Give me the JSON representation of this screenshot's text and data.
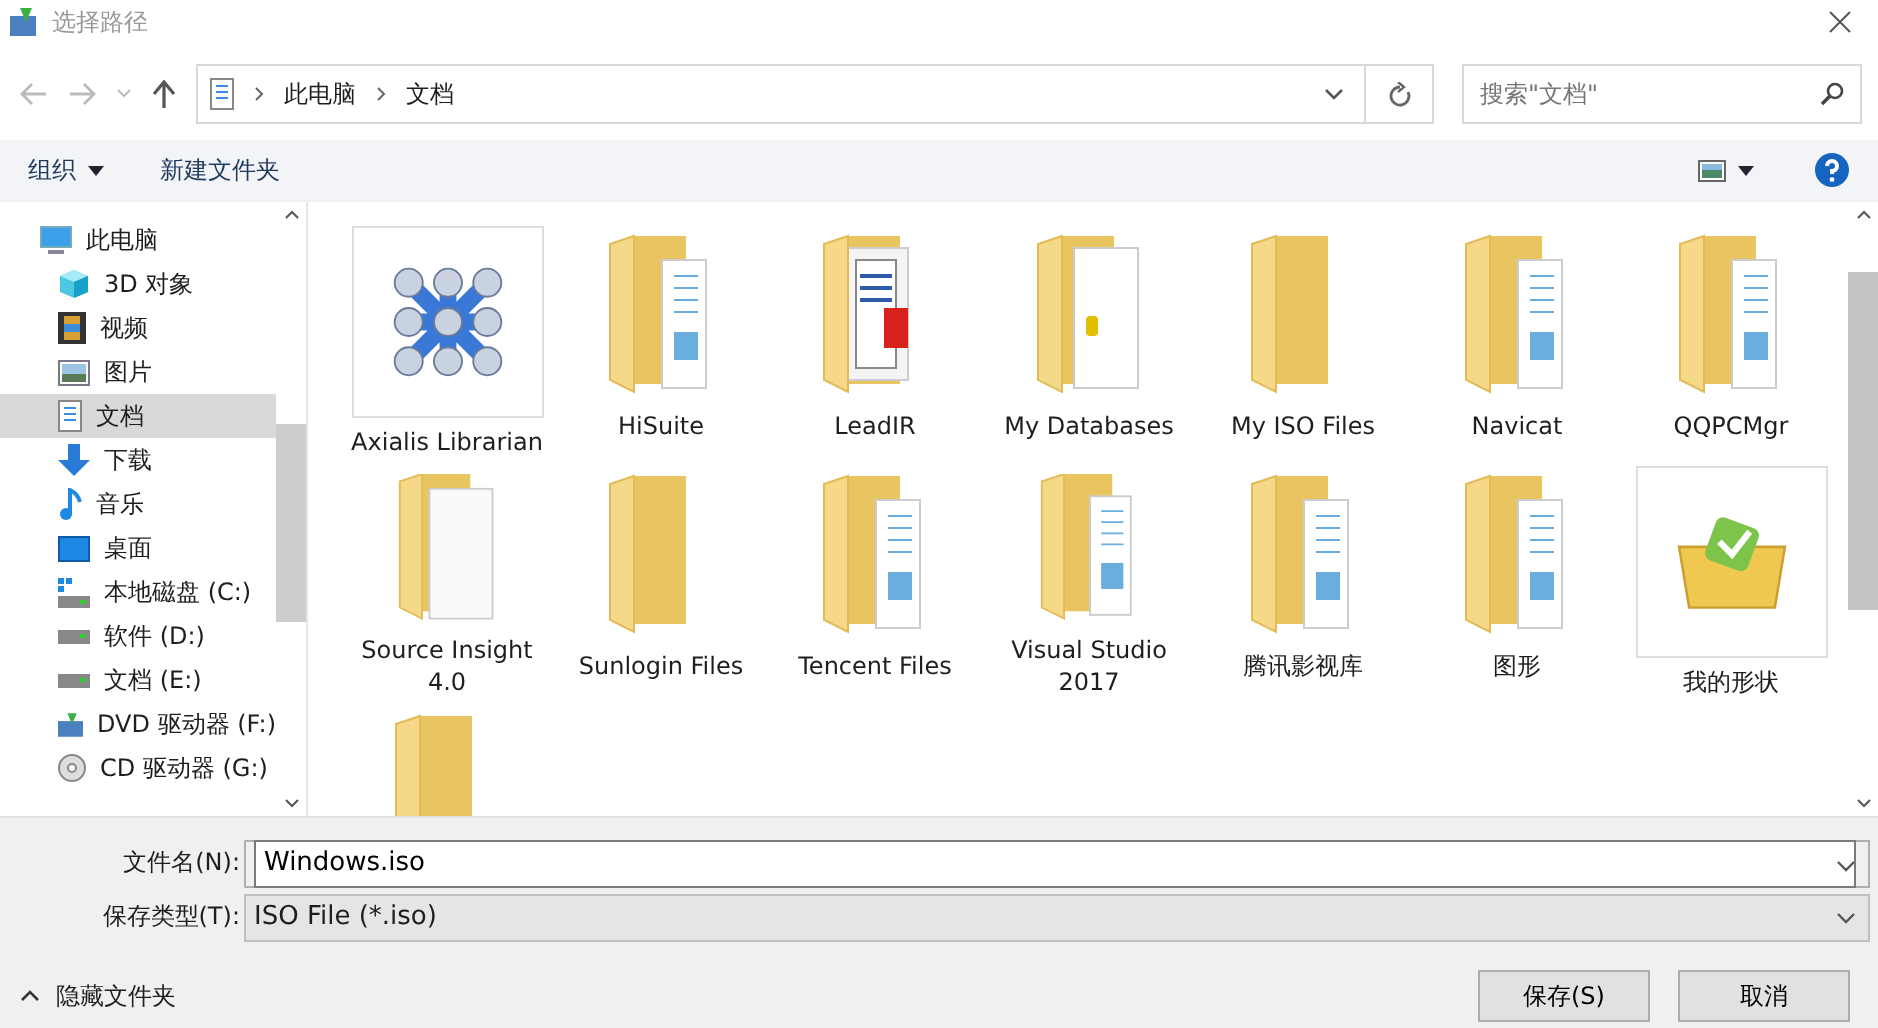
{
  "window": {
    "title": "选择路径"
  },
  "address": {
    "path": [
      "此电脑",
      "文档"
    ]
  },
  "search": {
    "placeholder": "搜索\"文档\""
  },
  "toolbar": {
    "organize": "组织",
    "new_folder": "新建文件夹"
  },
  "sidebar": {
    "items": [
      {
        "label": "此电脑",
        "kind": "pc",
        "selected": false,
        "children": [
          {
            "label": "3D 对象",
            "kind": "cube",
            "selected": false
          },
          {
            "label": "视频",
            "kind": "video",
            "selected": false
          },
          {
            "label": "图片",
            "kind": "picture",
            "selected": false
          },
          {
            "label": "文档",
            "kind": "document",
            "selected": true
          },
          {
            "label": "下载",
            "kind": "download",
            "selected": false
          },
          {
            "label": "音乐",
            "kind": "music",
            "selected": false
          },
          {
            "label": "桌面",
            "kind": "desktop",
            "selected": false
          },
          {
            "label": "本地磁盘 (C:)",
            "kind": "system-drive",
            "selected": false
          },
          {
            "label": "软件 (D:)",
            "kind": "drive",
            "selected": false
          },
          {
            "label": "文档 (E:)",
            "kind": "drive",
            "selected": false
          },
          {
            "label": "DVD 驱动器 (F:)",
            "kind": "dvd",
            "selected": false
          },
          {
            "label": "CD 驱动器 (G:)",
            "kind": "cd",
            "selected": false
          }
        ]
      }
    ]
  },
  "files": [
    {
      "name": "Axialis Librarian",
      "kind": "app"
    },
    {
      "name": "HiSuite",
      "kind": "folder-files"
    },
    {
      "name": "LeadIR",
      "kind": "folder-documents"
    },
    {
      "name": "My Databases",
      "kind": "folder-page"
    },
    {
      "name": "My ISO Files",
      "kind": "folder"
    },
    {
      "name": "Navicat",
      "kind": "folder-files"
    },
    {
      "name": "QQPCMgr",
      "kind": "folder-files"
    },
    {
      "name": "Source Insight 4.0",
      "kind": "folder-blank"
    },
    {
      "name": "Sunlogin Files",
      "kind": "folder"
    },
    {
      "name": "Tencent Files",
      "kind": "folder-files"
    },
    {
      "name": "Visual Studio 2017",
      "kind": "folder-files"
    },
    {
      "name": "腾讯影视库",
      "kind": "folder-files"
    },
    {
      "name": "图形",
      "kind": "folder-files"
    },
    {
      "name": "我的形状",
      "kind": "shapes"
    },
    {
      "kind": "folder"
    }
  ],
  "form": {
    "filename_label": "文件名(N):",
    "filename": "Windows.iso",
    "type_label": "保存类型(T):",
    "type": "ISO File (*.iso)"
  },
  "hide_folders": "隐藏文件夹",
  "buttons": [
    "保存(S)",
    "取消"
  ]
}
